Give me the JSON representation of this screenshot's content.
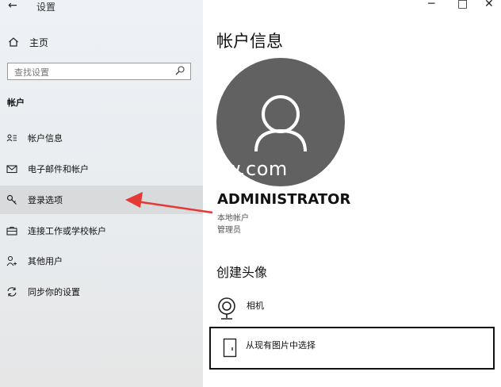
{
  "window": {
    "title": "设置",
    "back_icon": "arrow-left-icon",
    "controls": {
      "minimize": "─",
      "maximize": "□",
      "close": "✕"
    }
  },
  "sidebar": {
    "home_label": "主页",
    "search_placeholder": "查找设置",
    "section_title": "帐户",
    "items": [
      {
        "label": "帐户信息",
        "icon": "account-info-icon"
      },
      {
        "label": "电子邮件和帐户",
        "icon": "mail-icon"
      },
      {
        "label": "登录选项",
        "icon": "key-icon",
        "selected": true
      },
      {
        "label": "连接工作或学校帐户",
        "icon": "briefcase-icon"
      },
      {
        "label": "其他用户",
        "icon": "person-add-icon"
      },
      {
        "label": "同步你的设置",
        "icon": "sync-icon"
      }
    ]
  },
  "main": {
    "title": "帐户信息",
    "watermark": "w.com",
    "username": "ADMINISTRATOR",
    "account_type": "本地帐户",
    "role": "管理员",
    "create_avatar_heading": "创建头像",
    "camera_label": "相机",
    "browse_label": "从现有图片中选择"
  },
  "colors": {
    "avatar_bg": "#616161",
    "selected_item_bg": "#d8dadc",
    "annotation_arrow": "#e53935"
  }
}
